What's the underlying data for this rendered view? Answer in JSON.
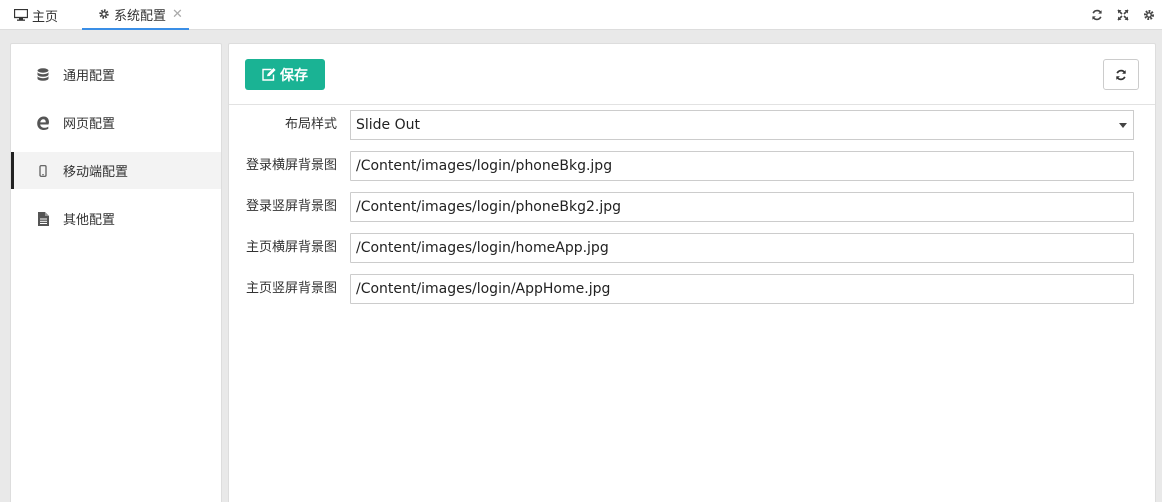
{
  "tabs": [
    {
      "label": "主页",
      "icon": "monitor-icon"
    },
    {
      "label": "系统配置",
      "icon": "gear-icon",
      "closable": true
    }
  ],
  "top_actions": [
    "refresh-icon",
    "fullscreen-icon",
    "gear-icon"
  ],
  "sidebar": {
    "items": [
      {
        "label": "通用配置",
        "icon": "database-icon",
        "active": false
      },
      {
        "label": "网页配置",
        "icon": "edge-icon",
        "active": false
      },
      {
        "label": "移动端配置",
        "icon": "mobile-icon",
        "active": true
      },
      {
        "label": "其他配置",
        "icon": "file-icon",
        "active": false
      }
    ]
  },
  "toolbar": {
    "save_label": "保存",
    "accent": "#1ab394"
  },
  "form": {
    "layout": {
      "label": "布局样式",
      "value": "Slide Out"
    },
    "fields": [
      {
        "label": "登录横屏背景图",
        "value": "/Content/images/login/phoneBkg.jpg"
      },
      {
        "label": "登录竖屏背景图",
        "value": "/Content/images/login/phoneBkg2.jpg"
      },
      {
        "label": "主页横屏背景图",
        "value": "/Content/images/login/homeApp.jpg"
      },
      {
        "label": "主页竖屏背景图",
        "value": "/Content/images/login/AppHome.jpg"
      }
    ]
  }
}
